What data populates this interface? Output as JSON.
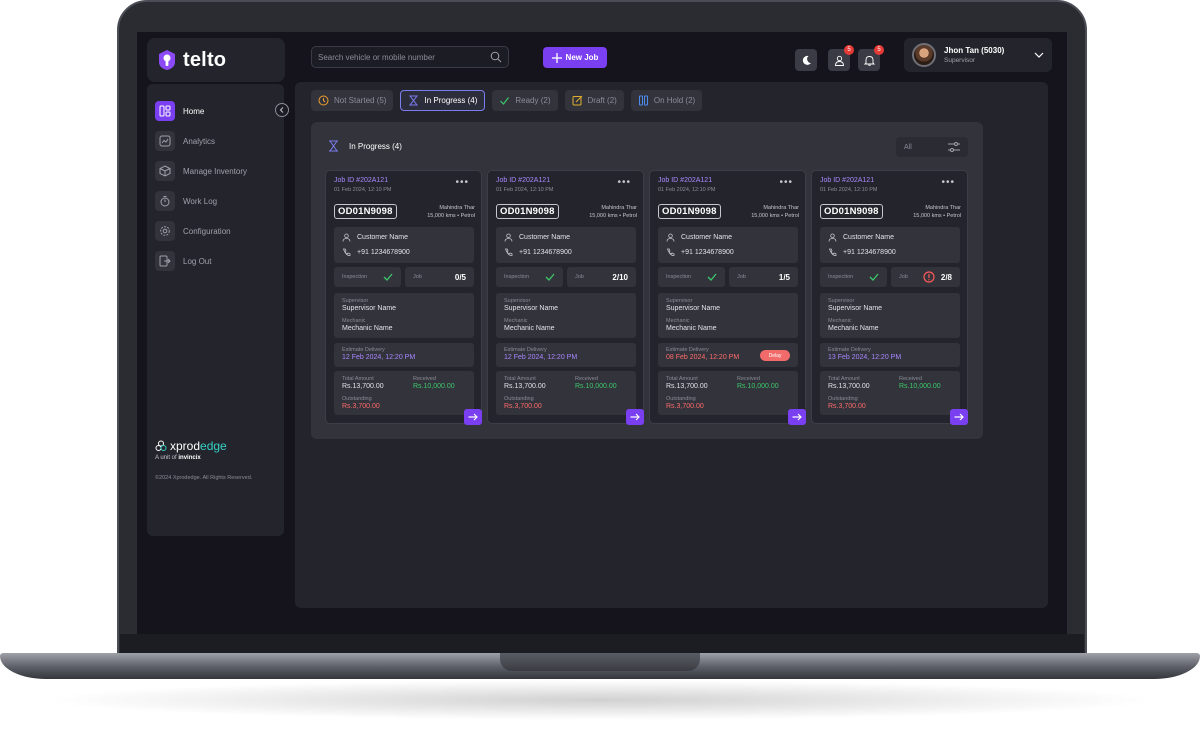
{
  "app": {
    "logo_text": "telto"
  },
  "search": {
    "placeholder": "Search vehicle or mobile number"
  },
  "toolbar": {
    "new_job_label": "New Job"
  },
  "header": {
    "profile_badge": "5",
    "notification_badge": "5",
    "user_name": "Jhon Tan (5030)",
    "user_role": "Supervisor"
  },
  "sidebar": {
    "items": [
      {
        "label": "Home"
      },
      {
        "label": "Analytics"
      },
      {
        "label": "Manage Inventory"
      },
      {
        "label": "Work Log"
      },
      {
        "label": "Configuration"
      },
      {
        "label": "Log Out"
      }
    ],
    "brand_prefix": "xprod",
    "brand_suffix": "edge",
    "brand_unit": "A unit of",
    "brand_parent": "invincix",
    "copyright": "©2024 Xprodedge. All Rights Reserved."
  },
  "tabs": [
    {
      "label": "Not Started (5)"
    },
    {
      "label": "In Progress (4)"
    },
    {
      "label": "Ready (2)"
    },
    {
      "label": "Draft (2)"
    },
    {
      "label": "On Hold (2)"
    }
  ],
  "panel": {
    "title": "In Progress (4)",
    "filter_value": "All"
  },
  "labels": {
    "inspection": "Inspection",
    "job": "Job",
    "supervisor": "Supervisor",
    "mechanic": "Mechanic",
    "estimate_delivery": "Estimate Delivery",
    "total_amount": "Total Amount",
    "received": "Received",
    "outstanding": "Outstanding",
    "delay": "Delay"
  },
  "cards": [
    {
      "job_id": "Job ID #202A121",
      "date": "01 Feb 2024, 12:10 PM",
      "plate": "OD01N9098",
      "vehicle": "Mahindra Thar",
      "vehicle_meta": "15,000 kms  •  Petrol",
      "customer": "Customer Name",
      "phone": "+91 1234678900",
      "job_count": "0/5",
      "supervisor": "Supervisor Name",
      "mechanic": "Mechanic Name",
      "delivery": "12 Feb 2024, 12:20 PM",
      "total": "Rs.13,700.00",
      "received": "Rs.10,000.00",
      "outstanding": "Rs.3,700.00"
    },
    {
      "job_id": "Job ID #202A121",
      "date": "01 Feb 2024, 12:10 PM",
      "plate": "OD01N9098",
      "vehicle": "Mahindra Thar",
      "vehicle_meta": "15,000 kms  •  Petrol",
      "customer": "Customer Name",
      "phone": "+91 1234678900",
      "job_count": "2/10",
      "supervisor": "Supervisor Name",
      "mechanic": "Mechanic Name",
      "delivery": "12 Feb 2024, 12:20 PM",
      "total": "Rs.13,700.00",
      "received": "Rs.10,000.00",
      "outstanding": "Rs.3,700.00"
    },
    {
      "job_id": "Job ID #202A121",
      "date": "01 Feb 2024, 12:10 PM",
      "plate": "OD01N9098",
      "vehicle": "Mahindra Thar",
      "vehicle_meta": "15,000 kms  •  Petrol",
      "customer": "Customer Name",
      "phone": "+91 1234678900",
      "job_count": "1/5",
      "supervisor": "Supervisor Name",
      "mechanic": "Mechanic Name",
      "delivery": "08 Feb 2024, 12:20 PM",
      "total": "Rs.13,700.00",
      "received": "Rs.10,000.00",
      "outstanding": "Rs.3,700.00"
    },
    {
      "job_id": "Job ID #202A121",
      "date": "01 Feb 2024, 12:10 PM",
      "plate": "OD01N9098",
      "vehicle": "Mahindra Thar",
      "vehicle_meta": "15,000 kms  •  Petrol",
      "customer": "Customer Name",
      "phone": "+91 1234678900",
      "job_count": "2/8",
      "supervisor": "Supervisor Name",
      "mechanic": "Mechanic Name",
      "delivery": "13 Feb 2024, 12:20 PM",
      "total": "Rs.13,700.00",
      "received": "Rs.10,000.00",
      "outstanding": "Rs.3,700.00"
    }
  ],
  "colors": {
    "accent": "#7b3ff2",
    "delay": "#f26b6b",
    "received": "#3cc86b",
    "outstanding": "#ff6b6b"
  }
}
